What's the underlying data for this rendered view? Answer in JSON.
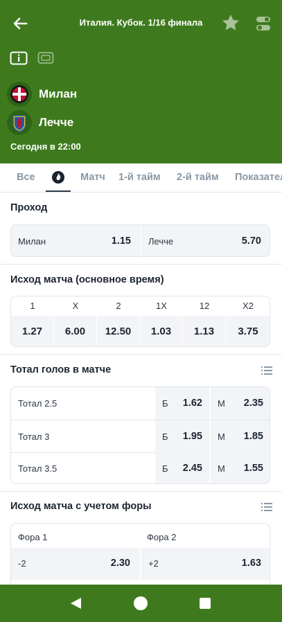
{
  "header": {
    "title": "Италия. Кубок. 1/16 финала",
    "teams": [
      {
        "name": "Милан"
      },
      {
        "name": "Лечче"
      }
    ],
    "match_time": "Сегодня в 22:00"
  },
  "tabs": [
    {
      "label": "Все"
    },
    {
      "label": "Матч"
    },
    {
      "label": "1-й тайм"
    },
    {
      "label": "2-й тайм"
    },
    {
      "label": "Показатели"
    }
  ],
  "sections": {
    "pass": {
      "title": "Проход",
      "options": [
        {
          "label": "Милан",
          "odds": "1.15"
        },
        {
          "label": "Лечче",
          "odds": "5.70"
        }
      ]
    },
    "outcome": {
      "title": "Исход матча (основное время)",
      "headers": [
        "1",
        "X",
        "2",
        "1X",
        "12",
        "X2"
      ],
      "odds": [
        "1.27",
        "6.00",
        "12.50",
        "1.03",
        "1.13",
        "3.75"
      ]
    },
    "totals": {
      "title": "Тотал голов в матче",
      "under_label": "Б",
      "over_label": "М",
      "rows": [
        {
          "label": "Тотал 2.5",
          "under": "1.62",
          "over": "2.35"
        },
        {
          "label": "Тотал 3",
          "under": "1.95",
          "over": "1.85"
        },
        {
          "label": "Тотал 3.5",
          "under": "2.45",
          "over": "1.55"
        }
      ]
    },
    "handicap": {
      "title": "Исход матча с учетом форы",
      "headers": [
        "Фора 1",
        "Фора 2"
      ],
      "rows": [
        {
          "h1": "-2",
          "h1_odds": "2.30",
          "h2": "+2",
          "h2_odds": "1.63"
        }
      ]
    }
  },
  "colors": {
    "header_bg": "#3e7a1d",
    "nav_bg": "#3e7a1d",
    "cell_bg": "#f2f4f7",
    "text": "#1c2430",
    "tab_inactive": "#8a97a5"
  }
}
